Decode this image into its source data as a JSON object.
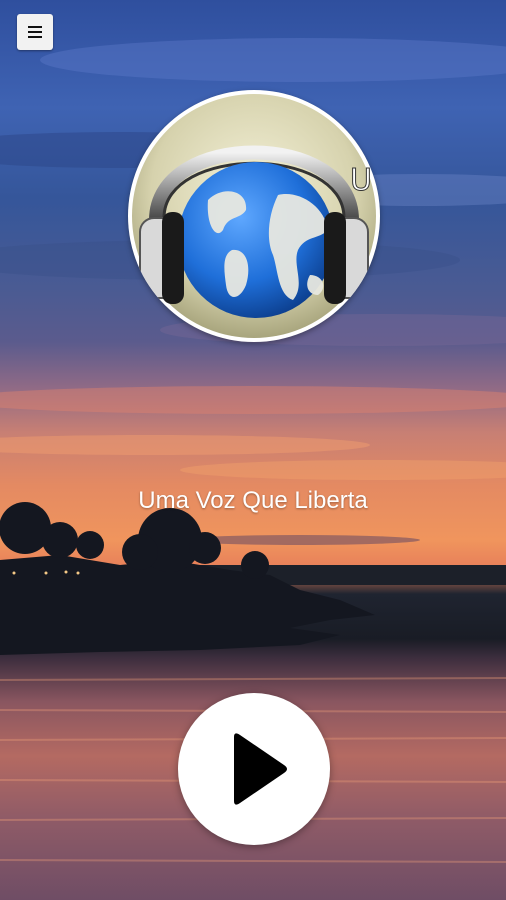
{
  "app": {
    "station_name": "Uma Voz Que Liberta"
  },
  "icons": {
    "menu": "hamburger-menu-icon",
    "play": "play-icon",
    "logo": "headphones-globe-logo"
  },
  "colors": {
    "button_bg": "#ffffff",
    "icon_color": "#000000",
    "text_color": "#ffffff"
  }
}
